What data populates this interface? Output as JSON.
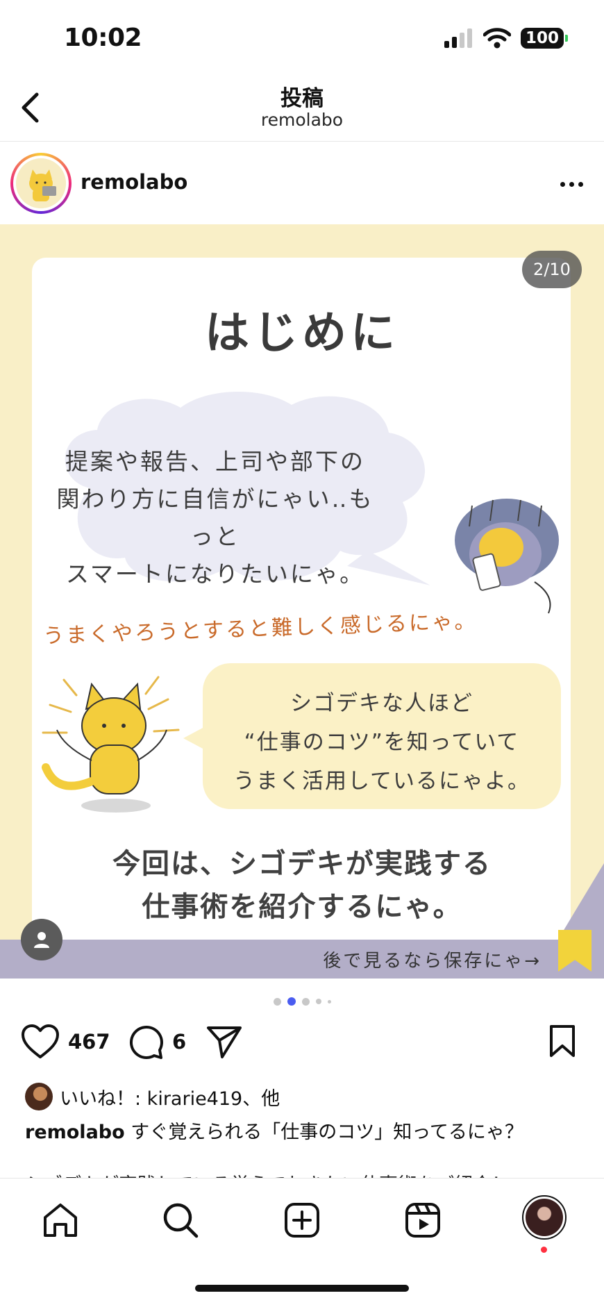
{
  "status_bar": {
    "time": "10:02",
    "battery": "100"
  },
  "header": {
    "title": "投稿",
    "subtitle": "remolabo"
  },
  "post": {
    "username": "remolabo",
    "page_counter": "2/10",
    "image": {
      "heading": "はじめに",
      "cloud_lines": [
        "提案や報告、上司や部下の",
        "関わり方に自信がにゃい‥もっと",
        "スマートになりたいにゃ。"
      ],
      "orange_text": "うまくやろうとすると難しく感じるにゃ。",
      "bubble_lines": [
        "シゴデキな人ほど",
        "“仕事のコツ”を知っていて",
        "うまく活用しているにゃよ。"
      ],
      "bottom_lines": [
        "今回は、シゴデキが実践する",
        "仕事術を紹介するにゃ。"
      ],
      "save_text": "後で見るなら保存にゃ→"
    },
    "carousel": {
      "current_index": 2,
      "dot_count": 5
    },
    "likes_count": "467",
    "comments_count": "6",
    "likes_label": "いいね！: kirarie419、他",
    "caption_user": "remolabo",
    "caption_text": "すぐ覚えられる「仕事のコツ」知ってるにゃ？",
    "caption_line2": "シゴデキが実践している覚えておきたい仕事術をご紹介！"
  },
  "icons": {
    "back": "chevron-left-icon",
    "more": "more-horizontal-icon",
    "like": "heart-icon",
    "comment": "comment-icon",
    "share": "send-icon",
    "save": "bookmark-icon",
    "tag": "person-icon",
    "home": "home-icon",
    "search": "search-icon",
    "create": "plus-square-icon",
    "reels": "reels-icon"
  },
  "colors": {
    "accent_dot": "#4a5cf0",
    "notification": "#ff3040",
    "card_bg": "#f9efc7",
    "bubble_bg": "#fbf1c6",
    "strip": "#b3aec8",
    "orange": "#c96a2a"
  }
}
